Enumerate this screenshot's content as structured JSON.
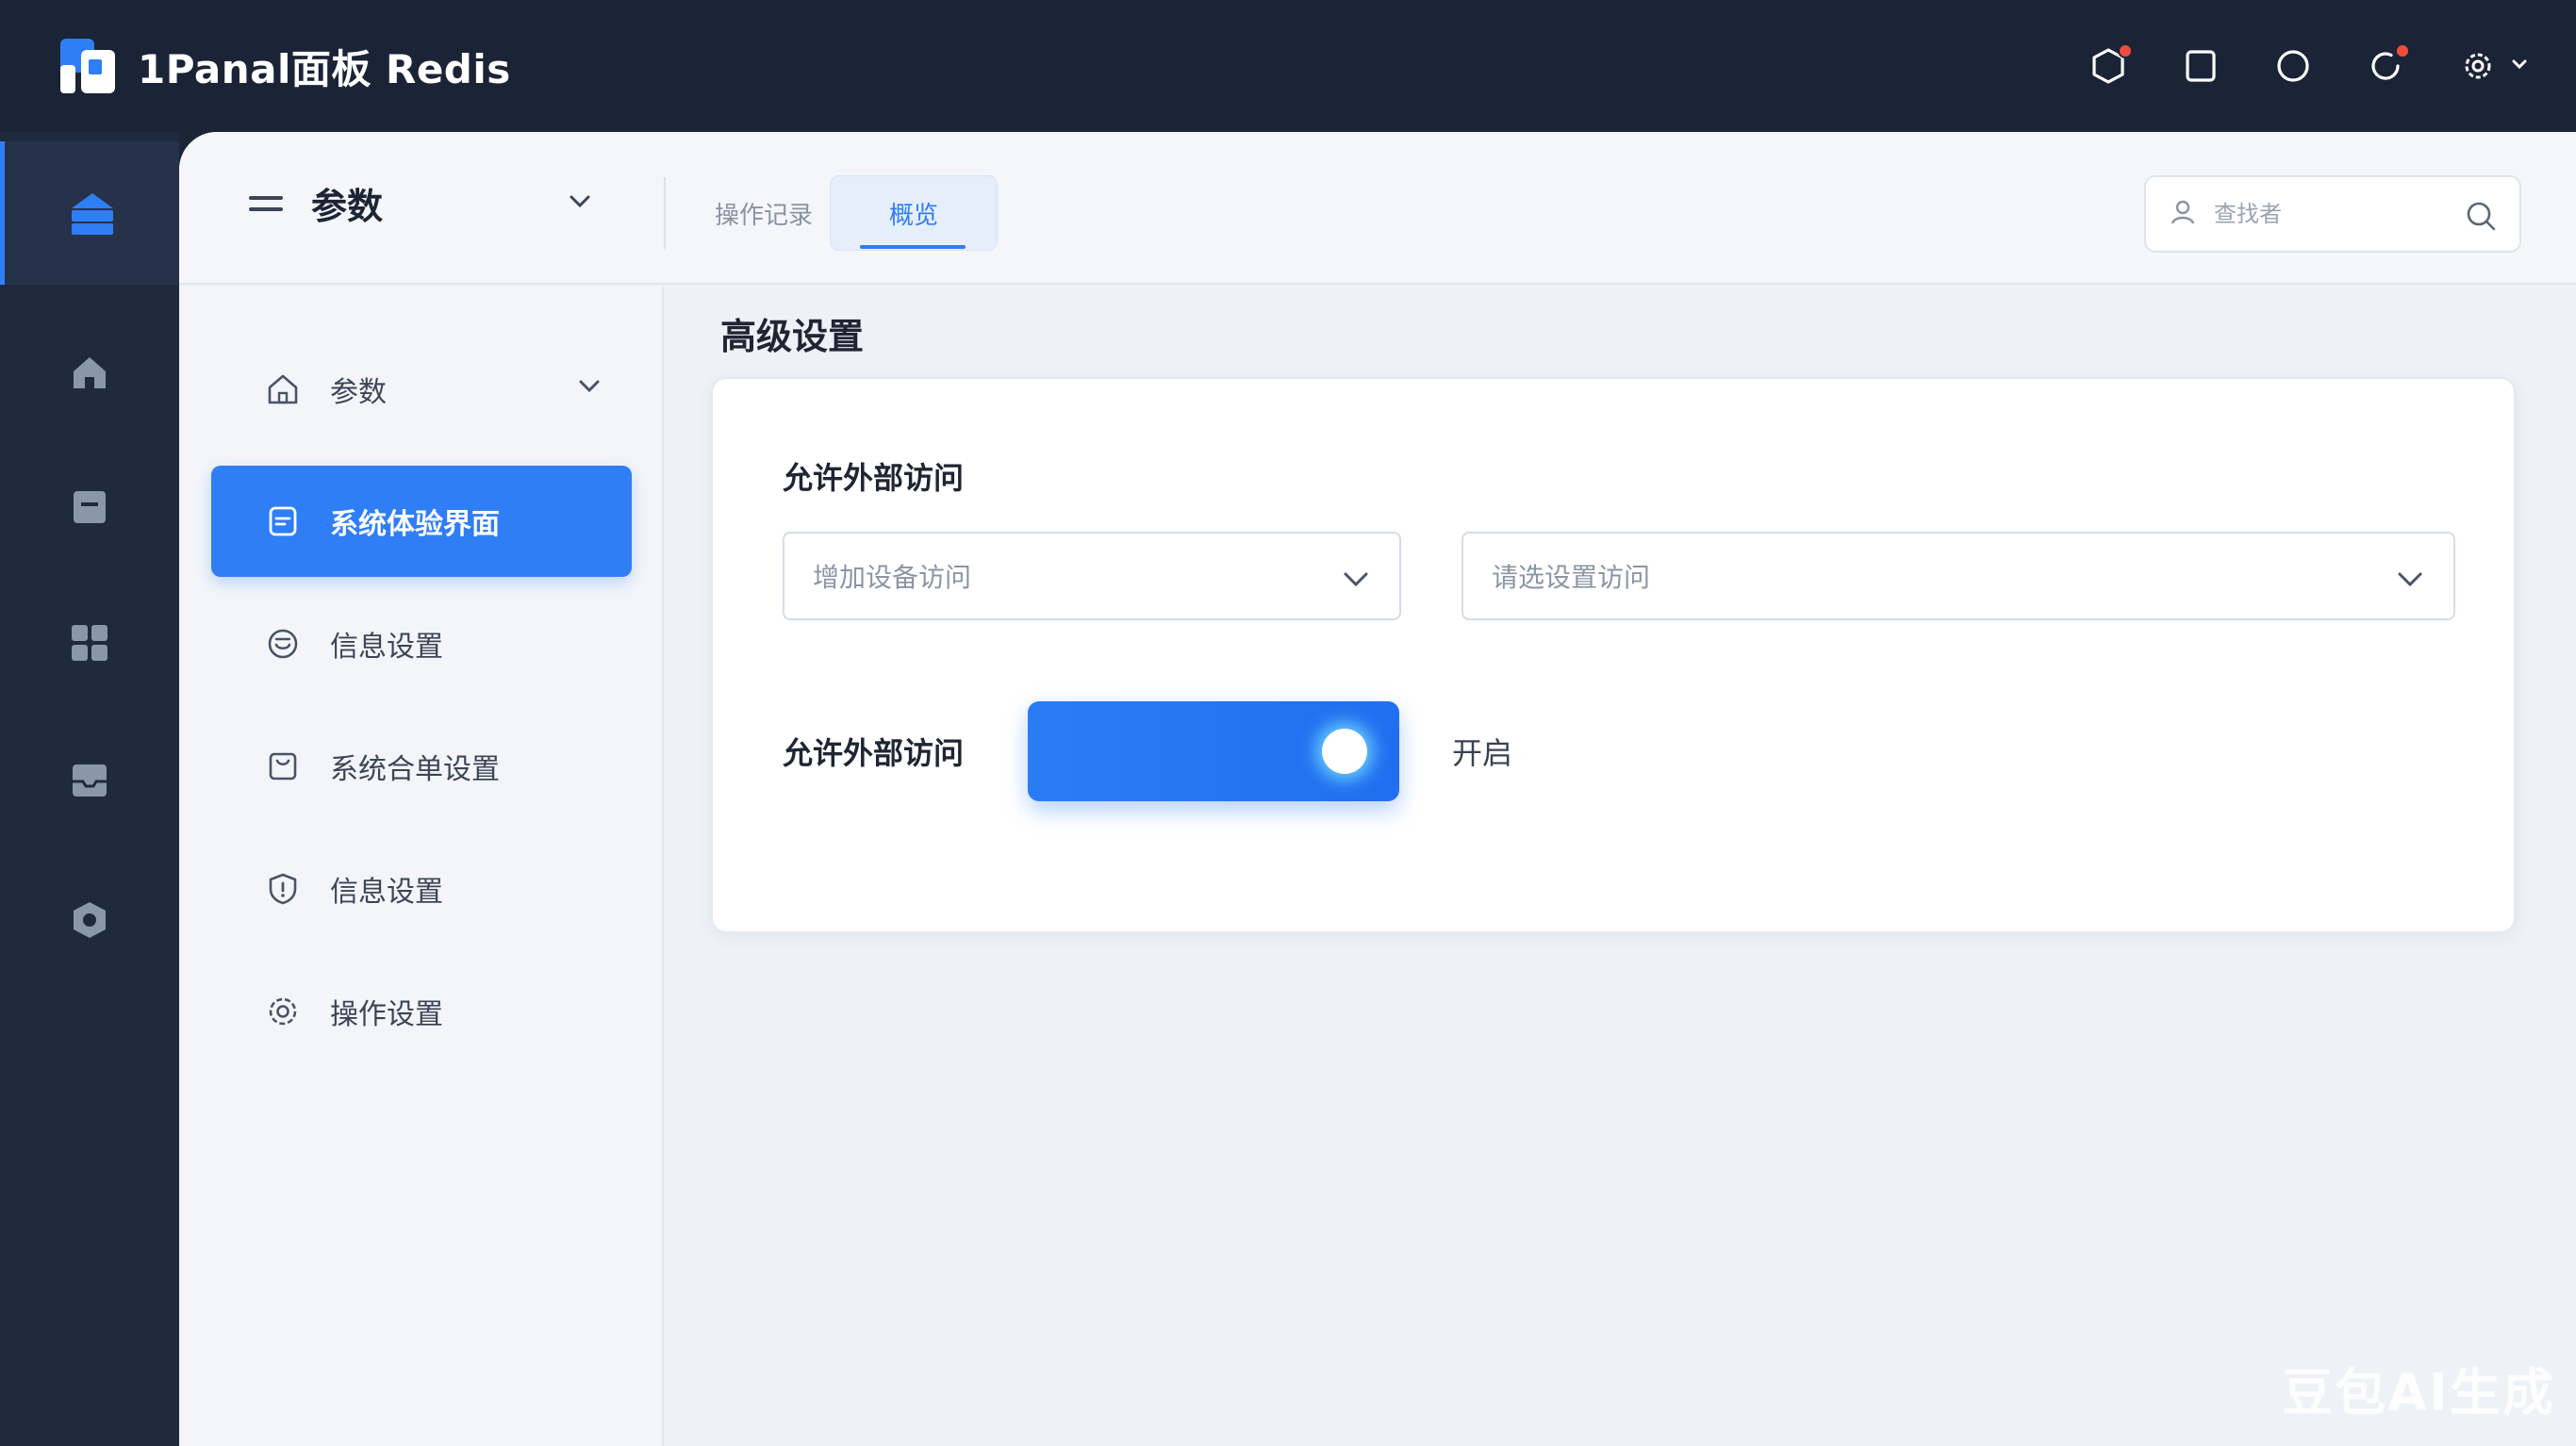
{
  "app": {
    "title": "1Panal面板 Redis"
  },
  "header": {
    "menu_label": "参数",
    "tabs": [
      {
        "label": "操作记录"
      },
      {
        "label": "概览"
      }
    ],
    "search_placeholder": "查找者"
  },
  "sidebar": {
    "items": [
      {
        "label": "参数",
        "icon": "home-outline-icon"
      },
      {
        "label": "系统体验界面",
        "icon": "document-icon"
      },
      {
        "label": "信息设置",
        "icon": "smile-chat-icon"
      },
      {
        "label": "系统合单设置",
        "icon": "inbox-icon"
      },
      {
        "label": "信息设置",
        "icon": "shield-icon"
      },
      {
        "label": "操作设置",
        "icon": "gear-icon"
      }
    ]
  },
  "content": {
    "section_title": "高级设置",
    "access_label": "允许外部访问",
    "select_left": "增加设备访问",
    "select_right": "请选设置访问",
    "toggle_label": "允许外部访问",
    "toggle_state": "开启",
    "toggle_on": true
  },
  "watermark": "豆包AI生成",
  "colors": {
    "accent": "#2f7ef5",
    "topbar": "#1b2436",
    "badge": "#f04b3a"
  }
}
